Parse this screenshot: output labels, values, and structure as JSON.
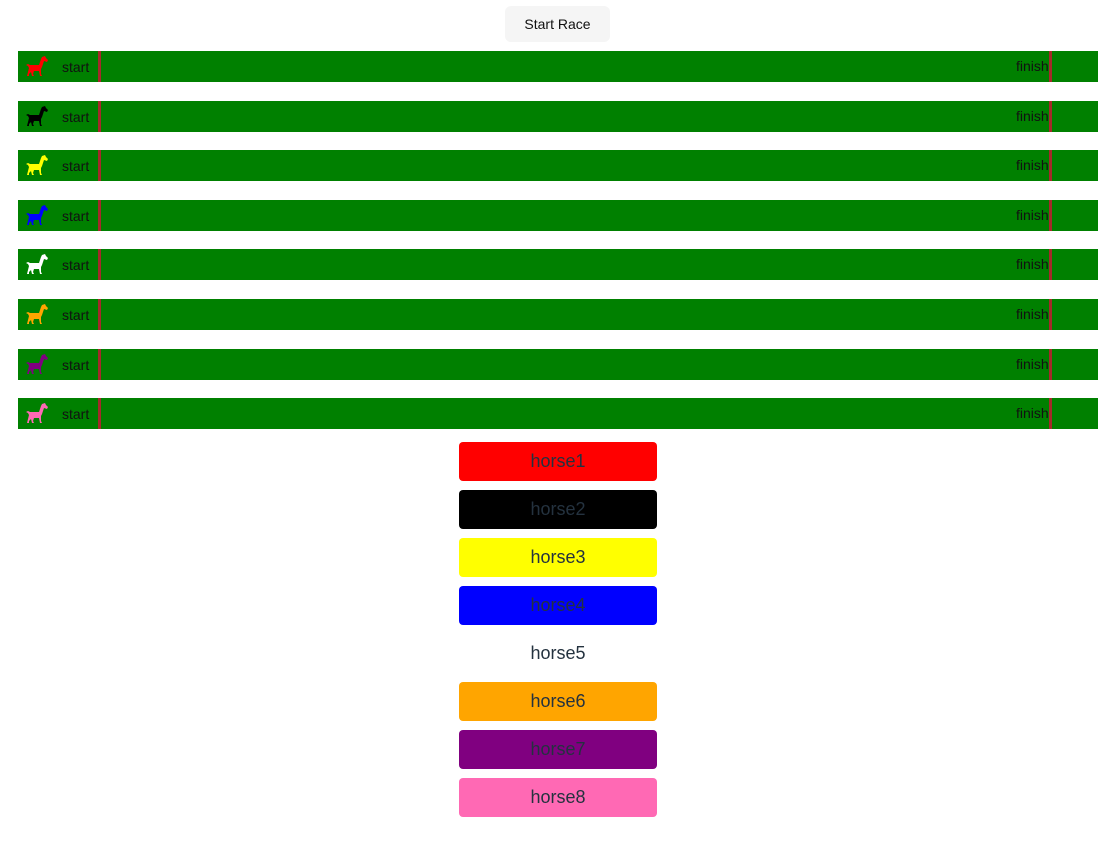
{
  "toolbar": {
    "start_label": "Start Race"
  },
  "lanes": [
    {
      "horse_color": "#ff0000",
      "start_label": "start",
      "finish_label": "finish"
    },
    {
      "horse_color": "#000000",
      "start_label": "start",
      "finish_label": "finish"
    },
    {
      "horse_color": "#ffff00",
      "start_label": "start",
      "finish_label": "finish"
    },
    {
      "horse_color": "#0000ff",
      "start_label": "start",
      "finish_label": "finish"
    },
    {
      "horse_color": "#ffffff",
      "start_label": "start",
      "finish_label": "finish"
    },
    {
      "horse_color": "#ffa500",
      "start_label": "start",
      "finish_label": "finish"
    },
    {
      "horse_color": "#800080",
      "start_label": "start",
      "finish_label": "finish"
    },
    {
      "horse_color": "#ff69b4",
      "start_label": "start",
      "finish_label": "finish"
    }
  ],
  "horse_buttons": [
    {
      "label": "horse1",
      "color": "#ff0000"
    },
    {
      "label": "horse2",
      "color": "#000000"
    },
    {
      "label": "horse3",
      "color": "#ffff00"
    },
    {
      "label": "horse4",
      "color": "#0000ff"
    },
    {
      "label": "horse5",
      "color": "#ffffff"
    },
    {
      "label": "horse6",
      "color": "#ffa500"
    },
    {
      "label": "horse7",
      "color": "#800080"
    },
    {
      "label": "horse8",
      "color": "#ff69b4"
    }
  ],
  "icons": {
    "horse": "horse-icon"
  }
}
